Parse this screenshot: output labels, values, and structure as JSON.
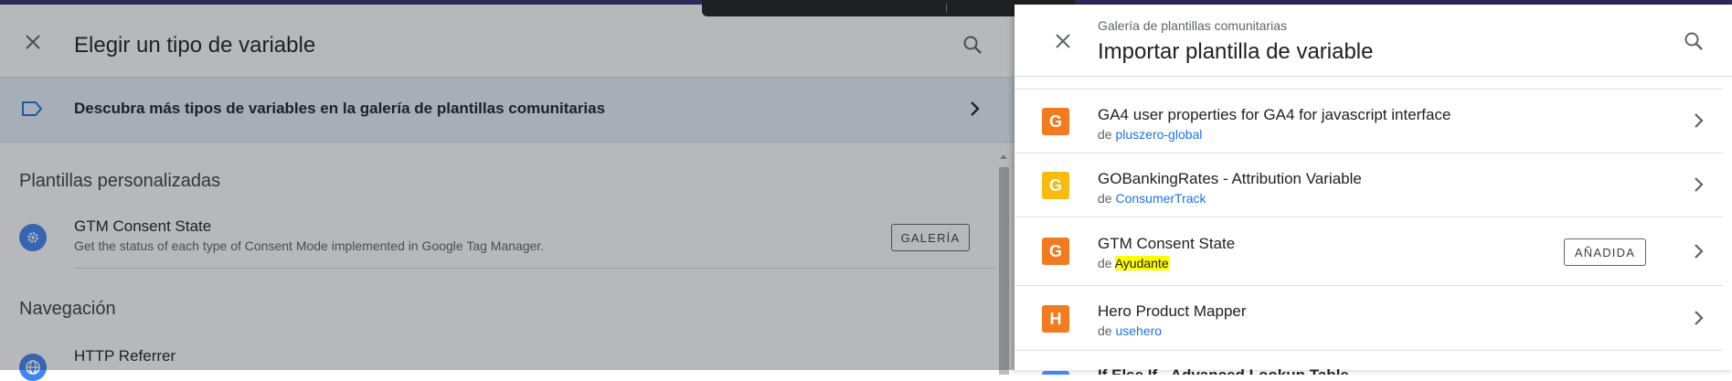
{
  "left_panel": {
    "title": "Elegir un tipo de variable",
    "banner": {
      "text": "Descubra más tipos de variables en la galería de plantillas comunitarias"
    },
    "sections": [
      {
        "title": "Plantillas personalizadas",
        "items": [
          {
            "title": "GTM Consent State",
            "subtitle": "Get the status of each type of Consent Mode implemented in Google Tag Manager.",
            "badge": "GALERÍA",
            "icon": "gear-icon"
          }
        ]
      },
      {
        "title": "Navegación",
        "items": [
          {
            "title": "HTTP Referrer",
            "icon": "globe-icon"
          }
        ]
      }
    ]
  },
  "right_panel": {
    "breadcrumb": "Galería de plantillas comunitarias",
    "title": "Importar plantilla de variable",
    "by_prefix": "de",
    "templates": [
      {
        "letter": "G",
        "name": "GA4 user properties for GA4 for javascript interface",
        "author": "pluszero-global",
        "color": "#f47a20"
      },
      {
        "letter": "G",
        "name": "GOBankingRates - Attribution Variable",
        "author": "ConsumerTrack",
        "color": "#f9bb0f"
      },
      {
        "letter": "G",
        "name": "GTM Consent State",
        "author": "Ayudante",
        "author_highlighted": true,
        "badge": "AÑADIDA",
        "color": "#f47a20"
      },
      {
        "letter": "H",
        "name": "Hero Product Mapper",
        "author": "usehero",
        "color": "#f47a20"
      },
      {
        "name": "If Else If - Advanced Lookup Table"
      }
    ]
  },
  "colors": {
    "accent": "#1a73e8",
    "banner_bg": "#e8f0fe",
    "highlight": "#ffff00"
  }
}
